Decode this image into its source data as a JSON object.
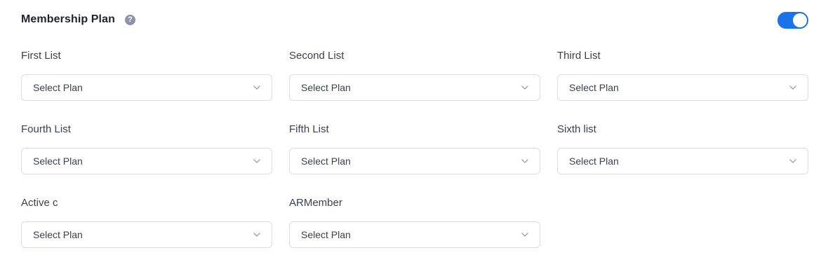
{
  "section": {
    "title": "Membership Plan",
    "help_icon": "question-circle-icon",
    "toggle_enabled": true,
    "toggle_color": "#1a73e8"
  },
  "fields": [
    {
      "label": "First List",
      "value": "Select Plan"
    },
    {
      "label": "Second List",
      "value": "Select Plan"
    },
    {
      "label": "Third List",
      "value": "Select Plan"
    },
    {
      "label": "Fourth List",
      "value": "Select Plan"
    },
    {
      "label": "Fifth List",
      "value": "Select Plan"
    },
    {
      "label": "Sixth list",
      "value": "Select Plan"
    },
    {
      "label": "Active c",
      "value": "Select Plan"
    },
    {
      "label": "ARMember",
      "value": "Select Plan"
    }
  ],
  "icons": {
    "help": "?",
    "dropdown": "chevron-down-icon"
  }
}
